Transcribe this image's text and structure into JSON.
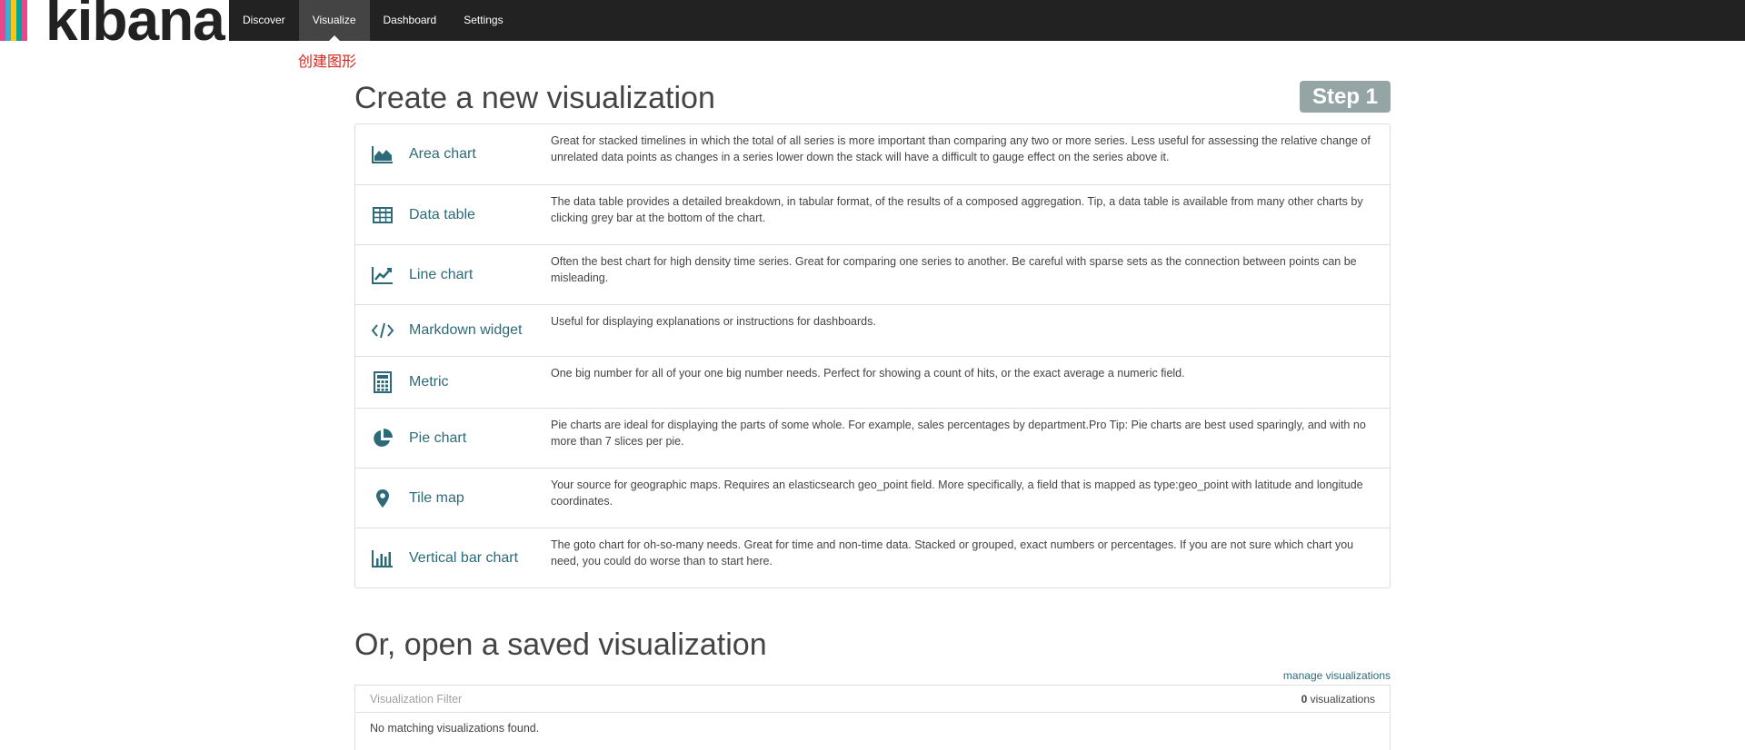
{
  "app": {
    "logo_text": "kibana",
    "logo_colors": [
      "#e8488b",
      "#3caed2",
      "#fec514",
      "#00a69b",
      "#e8488b"
    ]
  },
  "nav": {
    "items": [
      {
        "label": "Discover",
        "active": false
      },
      {
        "label": "Visualize",
        "active": true
      },
      {
        "label": "Dashboard",
        "active": false
      },
      {
        "label": "Settings",
        "active": false
      }
    ]
  },
  "annotation": {
    "text": "创建图形",
    "color": "#d9231b"
  },
  "create": {
    "title": "Create a new visualization",
    "step_label": "Step 1",
    "types": [
      {
        "icon": "area-chart-icon",
        "name": "Area chart",
        "description": "Great for stacked timelines in which the total of all series is more important than comparing any two or more series. Less useful for assessing the relative change of unrelated data points as changes in a series lower down the stack will have a difficult to gauge effect on the series above it."
      },
      {
        "icon": "table-icon",
        "name": "Data table",
        "description": "The data table provides a detailed breakdown, in tabular format, of the results of a composed aggregation. Tip, a data table is available from many other charts by clicking grey bar at the bottom of the chart."
      },
      {
        "icon": "line-chart-icon",
        "name": "Line chart",
        "description": "Often the best chart for high density time series. Great for comparing one series to another. Be careful with sparse sets as the connection between points can be misleading."
      },
      {
        "icon": "code-icon",
        "name": "Markdown widget",
        "description": "Useful for displaying explanations or instructions for dashboards."
      },
      {
        "icon": "calculator-icon",
        "name": "Metric",
        "description": "One big number for all of your one big number needs. Perfect for showing a count of hits, or the exact average a numeric field."
      },
      {
        "icon": "pie-chart-icon",
        "name": "Pie chart",
        "description": "Pie charts are ideal for displaying the parts of some whole. For example, sales percentages by department.Pro Tip: Pie charts are best used sparingly, and with no more than 7 slices per pie."
      },
      {
        "icon": "map-marker-icon",
        "name": "Tile map",
        "description": "Your source for geographic maps. Requires an elasticsearch geo_point field. More specifically, a field that is mapped as type:geo_point with latitude and longitude coordinates."
      },
      {
        "icon": "bar-chart-icon",
        "name": "Vertical bar chart",
        "description": "The goto chart for oh-so-many needs. Great for time and non-time data. Stacked or grouped, exact numbers or percentages. If you are not sure which chart you need, you could do worse than to start here."
      }
    ]
  },
  "saved": {
    "title": "Or, open a saved visualization",
    "manage_link": "manage visualizations",
    "filter_placeholder": "Visualization Filter",
    "count": "0",
    "count_label": "visualizations",
    "empty_message": "No matching visualizations found."
  },
  "colors": {
    "navbar_bg": "#222222",
    "active_nav_bg": "#444444",
    "link": "#2d6a78",
    "step_badge": "#95a5a6"
  }
}
